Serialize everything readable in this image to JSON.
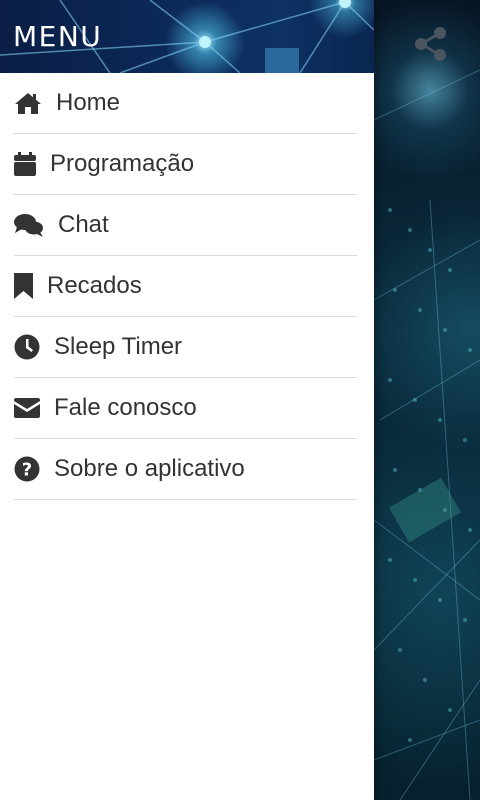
{
  "drawer": {
    "title": "MENU",
    "items": [
      {
        "label": "Home",
        "icon": "home-icon"
      },
      {
        "label": "Programação",
        "icon": "calendar-icon"
      },
      {
        "label": "Chat",
        "icon": "chat-bubbles-icon"
      },
      {
        "label": "Recados",
        "icon": "bookmark-icon"
      },
      {
        "label": "Sleep Timer",
        "icon": "clock-icon"
      },
      {
        "label": "Fale conosco",
        "icon": "envelope-icon"
      },
      {
        "label": "Sobre o aplicativo",
        "icon": "question-circle-icon"
      }
    ]
  },
  "app": {
    "share_icon": "share-icon"
  },
  "colors": {
    "drawer_bg": "#ffffff",
    "text": "#333333",
    "divider": "#dcdcdc",
    "header_bg": "#0c2a5a",
    "background": "#0a2638"
  }
}
